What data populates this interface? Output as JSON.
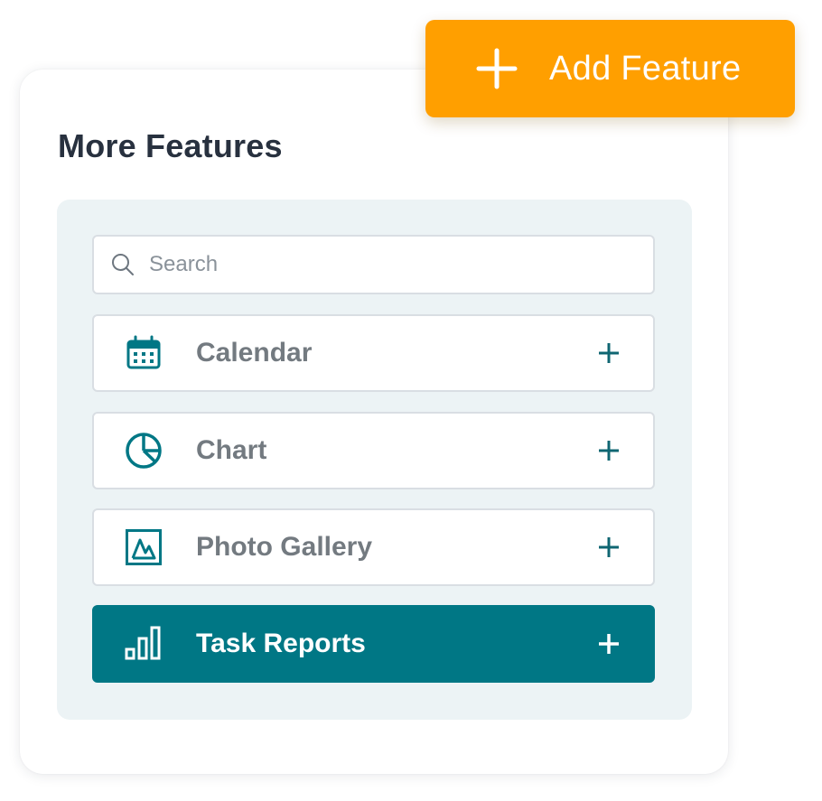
{
  "panel": {
    "title": "More Features",
    "search": {
      "placeholder": "Search",
      "value": ""
    },
    "features": [
      {
        "label": "Calendar",
        "icon": "calendar-icon",
        "selected": false
      },
      {
        "label": "Chart",
        "icon": "pie-chart-icon",
        "selected": false
      },
      {
        "label": "Photo Gallery",
        "icon": "image-icon",
        "selected": false
      },
      {
        "label": "Task Reports",
        "icon": "bar-chart-icon",
        "selected": true
      }
    ]
  },
  "add_feature_button": {
    "label": "Add Feature",
    "icon": "plus-icon"
  },
  "colors": {
    "accent_teal": "#007785",
    "button_orange": "#ff9f00",
    "panel_background": "#ecf3f5",
    "title_text": "#28313f",
    "item_text": "#737a80"
  }
}
